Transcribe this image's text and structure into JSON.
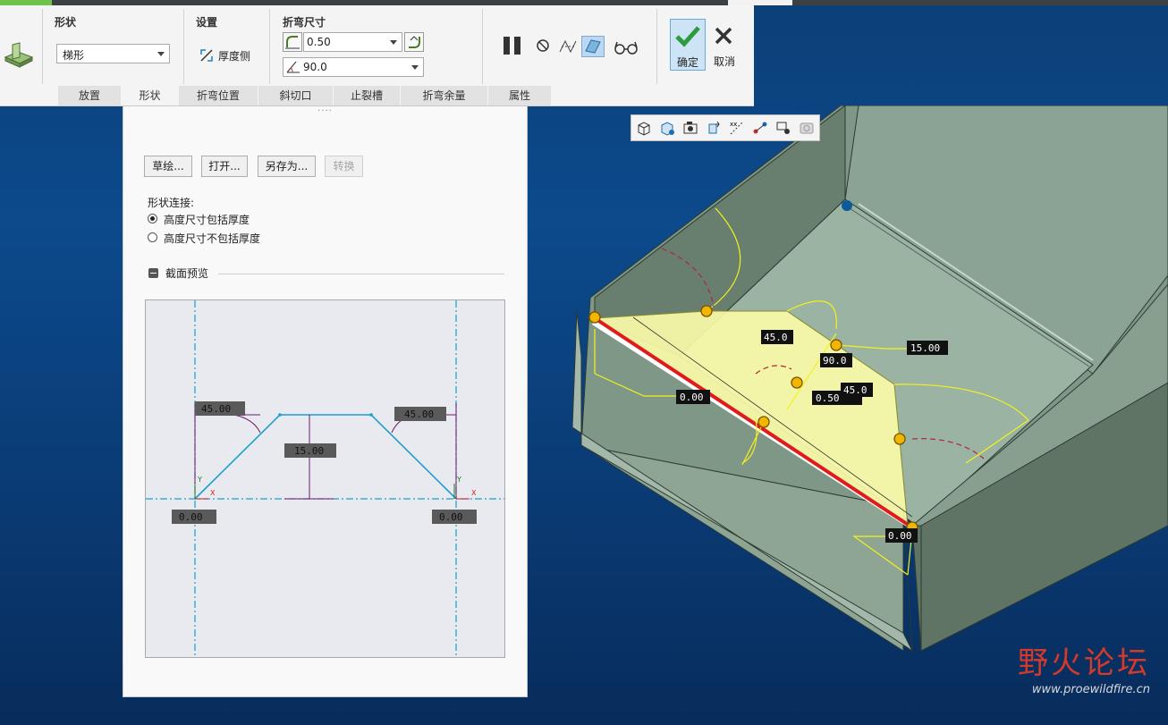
{
  "ribbon": {
    "groups": {
      "shape": {
        "title": "形状",
        "profile_value": "梯形"
      },
      "settings": {
        "title": "设置",
        "thickness_label": "厚度侧"
      },
      "bend_size": {
        "title": "折弯尺寸",
        "radius_value": "0.50",
        "angle_value": "90.0"
      }
    },
    "ok_label": "确定",
    "cancel_label": "取消",
    "tabs": [
      "放置",
      "形状",
      "折弯位置",
      "斜切口",
      "止裂槽",
      "折弯余量",
      "属性"
    ],
    "active_tab": "形状"
  },
  "panel": {
    "handle": "····",
    "buttons": {
      "sketch": "草绘...",
      "open": "打开...",
      "save_as": "另存为...",
      "convert": "转换"
    },
    "shape_connection_label": "形状连接:",
    "options": [
      "高度尺寸包括厚度",
      "高度尺寸不包括厚度"
    ],
    "selected_option": 0,
    "section_title": "截面预览",
    "preview": {
      "dims": {
        "left_angle": "45.00",
        "right_angle": "45.00",
        "height": "15.00",
        "left_offset": "0.00",
        "right_offset": "0.00"
      },
      "axis_x": "X",
      "axis_y": "Y"
    }
  },
  "model_labels": {
    "angle_top": "45.0",
    "bend_angle": "90.0",
    "length": "15.00",
    "radius": "0.50",
    "angle_right": "45.0",
    "edge_left": "0.00",
    "edge_right": "0.00"
  },
  "watermark": {
    "title": "野火论坛",
    "url": "www.proewildfire.cn"
  },
  "colors": {
    "ok_accent": "#2c9bd8",
    "active_green": "#6fc34b",
    "model_grey": "#8da394",
    "preview_line": "#1b9fd1",
    "dimension_yellow": "#f4f21a"
  }
}
